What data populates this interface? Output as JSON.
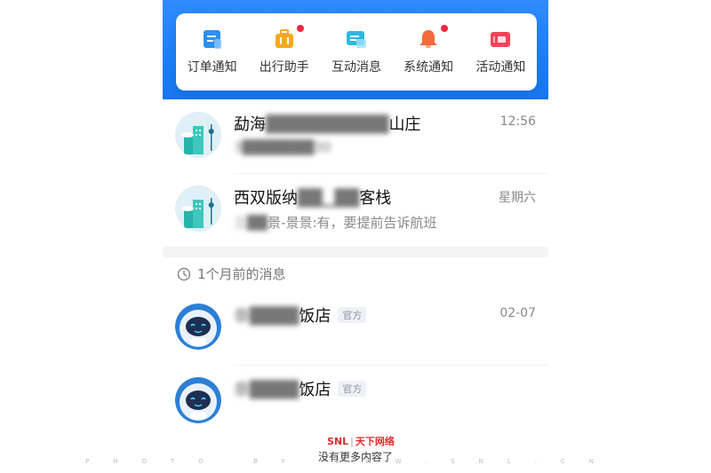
{
  "quick_menu": [
    {
      "label": "订单通知",
      "icon": "order-notice-icon",
      "color": "#2b90f0",
      "dot": false
    },
    {
      "label": "出行助手",
      "icon": "luggage-icon",
      "color": "#f6a91b",
      "dot": true
    },
    {
      "label": "互动消息",
      "icon": "chat-bubble-icon",
      "color": "#2fb7e0",
      "dot": false
    },
    {
      "label": "系统通知",
      "icon": "bell-icon",
      "color": "#f46a3b",
      "dot": true
    },
    {
      "label": "活动通知",
      "icon": "ticket-icon",
      "color": "#f0445a",
      "dot": false
    }
  ],
  "chats": [
    {
      "title_start": "勐海",
      "title_blur": "██████████",
      "title_end": "山庄",
      "time": "12:56",
      "preview_blur": "3███████30",
      "preview_text": ""
    },
    {
      "title_start": "西双版纳",
      "title_blur": "██▁██",
      "title_end": "客栈",
      "time": "星期六",
      "preview_blur": "三██",
      "preview_text": "景-景景:有，要提前告诉航班"
    }
  ],
  "section_title": "1个月前的消息",
  "official_chats": [
    {
      "title_blur": "泰████",
      "title_end": "饭店",
      "badge": "官方",
      "time": "02-07"
    },
    {
      "title_blur": "泰████",
      "title_end": "饭店",
      "badge": "官方",
      "time": ""
    }
  ],
  "footer": {
    "logo_main": "SNL",
    "logo_sub": "天下网络",
    "text": "没有更多内容了",
    "watermark": "PHOTO BY WWW.SNL.CN"
  },
  "colors": {
    "accent": "#1a7ff4",
    "dot": "#f2263a"
  }
}
